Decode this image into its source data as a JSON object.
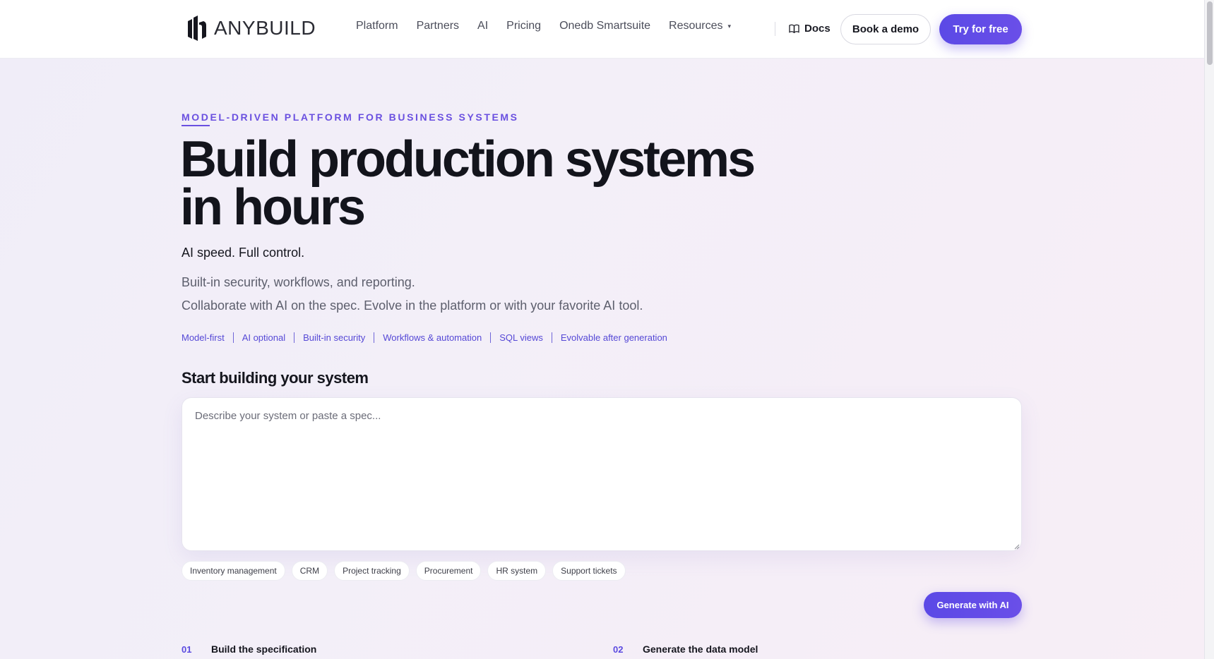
{
  "nav": {
    "logo_text": "ANYBUILD",
    "links": [
      {
        "label": "Platform"
      },
      {
        "label": "Partners"
      },
      {
        "label": "AI"
      },
      {
        "label": "Pricing"
      },
      {
        "label": "Onedb Smartsuite"
      },
      {
        "label": "Resources"
      }
    ],
    "resources_caret": "▾",
    "docs_label": "Docs",
    "demo_label": "Book a demo",
    "try_label": "Try for free"
  },
  "hero": {
    "eyebrow": "MODEL-DRIVEN PLATFORM FOR BUSINESS SYSTEMS",
    "headline_line1": "Build production systems",
    "headline_line2": "in hours",
    "tagline": "AI speed. Full control.",
    "desc1": "Built-in security, workflows, and reporting.",
    "desc2": "Collaborate with AI on the spec. Evolve in the platform or with your favorite AI tool.",
    "features": [
      "Model-first",
      "AI optional",
      "Built-in security",
      "Workflows & automation",
      "SQL views",
      "Evolvable after generation"
    ]
  },
  "builder": {
    "title": "Start building your system",
    "placeholder": "Describe your system or paste a spec...",
    "chips": [
      "Inventory management",
      "CRM",
      "Project tracking",
      "Procurement",
      "HR system",
      "Support tickets"
    ],
    "generate_label": "Generate with AI"
  },
  "steps": [
    {
      "num": "01",
      "title": "Build the specification"
    },
    {
      "num": "02",
      "title": "Generate the data model"
    }
  ],
  "colors": {
    "accent": "#5b49e6",
    "link": "#5548d6",
    "text": "#13141c"
  }
}
